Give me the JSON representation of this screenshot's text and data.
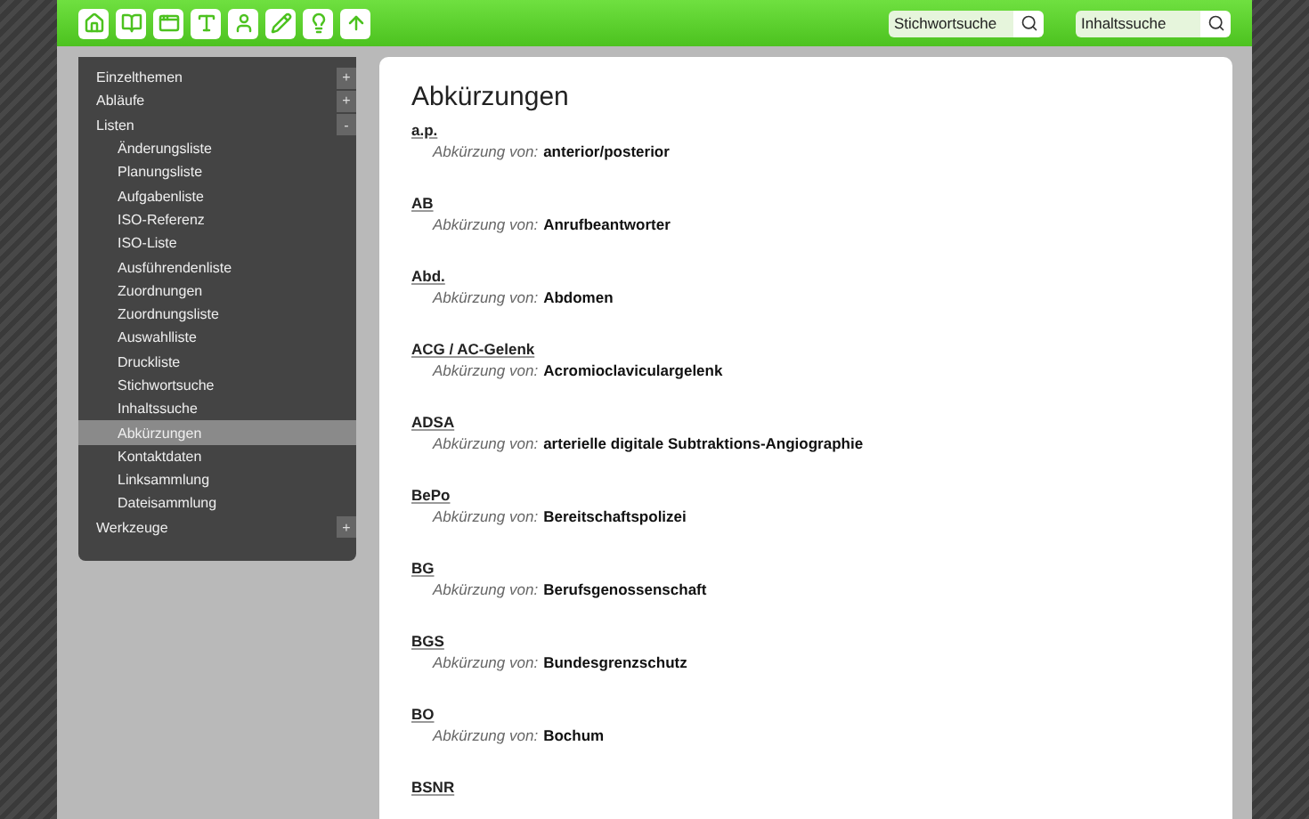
{
  "searches": [
    {
      "placeholder": "Stichwortsuche"
    },
    {
      "placeholder": "Inhaltssuche"
    }
  ],
  "sidebar": {
    "items": [
      {
        "label": "Einzelthemen",
        "toggle": "+",
        "selected": false
      },
      {
        "label": "Abläufe",
        "toggle": "+",
        "selected": false
      },
      {
        "label": "Listen",
        "toggle": "-",
        "selected": false,
        "children": [
          {
            "label": "Änderungsliste",
            "selected": false
          },
          {
            "label": "Planungsliste",
            "selected": false
          },
          {
            "label": "Aufgabenliste",
            "selected": false
          },
          {
            "label": "ISO-Referenz",
            "selected": false
          },
          {
            "label": "ISO-Liste",
            "selected": false
          },
          {
            "label": "Ausführendenliste",
            "selected": false
          },
          {
            "label": "Zuordnungen",
            "selected": false
          },
          {
            "label": "Zuordnungsliste",
            "selected": false
          },
          {
            "label": "Auswahlliste",
            "selected": false
          },
          {
            "label": "Druckliste",
            "selected": false
          },
          {
            "label": "Stichwortsuche",
            "selected": false
          },
          {
            "label": "Inhaltssuche",
            "selected": false
          },
          {
            "label": "Abkürzungen",
            "selected": true
          },
          {
            "label": "Kontaktdaten",
            "selected": false
          },
          {
            "label": "Linksammlung",
            "selected": false
          },
          {
            "label": "Dateisammlung",
            "selected": false
          }
        ]
      },
      {
        "label": "Werkzeuge",
        "toggle": "+",
        "selected": false
      }
    ]
  },
  "content": {
    "title": "Abkürzungen",
    "entries": [
      {
        "term": "a.p.",
        "label": "Abkürzung von:",
        "value": "anterior/posterior"
      },
      {
        "term": "AB",
        "label": "Abkürzung von:",
        "value": "Anrufbeantworter"
      },
      {
        "term": "Abd.",
        "label": "Abkürzung von:",
        "value": "Abdomen"
      },
      {
        "term": "ACG / AC-Gelenk",
        "label": "Abkürzung von:",
        "value": "Acromioclaviculargelenk"
      },
      {
        "term": "ADSA",
        "label": "Abkürzung von:",
        "value": "arterielle digitale Subtraktions-Angiographie"
      },
      {
        "term": "BePo",
        "label": "Abkürzung von:",
        "value": "Bereitschaftspolizei"
      },
      {
        "term": "BG",
        "label": "Abkürzung von:",
        "value": "Berufsgenossenschaft"
      },
      {
        "term": "BGS",
        "label": "Abkürzung von:",
        "value": "Bundesgrenzschutz"
      },
      {
        "term": "BO",
        "label": "Abkürzung von:",
        "value": "Bochum"
      },
      {
        "term": "BSNR"
      }
    ]
  }
}
